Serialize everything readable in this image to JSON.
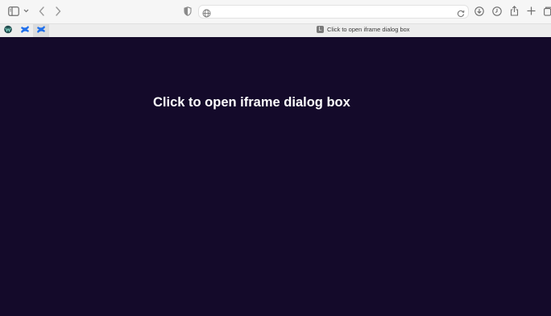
{
  "tab": {
    "favicon_letter": "L",
    "title": "Click to open iframe dialog box"
  },
  "address_bar": {
    "value": "",
    "placeholder": ""
  },
  "page": {
    "heading": "Click to open iframe dialog box",
    "background_color": "#140a2a",
    "text_color": "#ffffff"
  },
  "icons": {
    "sidebar": "sidebar-icon",
    "back": "chevron-left-icon",
    "forward": "chevron-right-icon",
    "privacy": "shield-icon",
    "download": "download-icon",
    "history": "clock-icon",
    "share": "share-icon",
    "new_tab": "plus-icon",
    "tab_overview": "tabs-overview-icon"
  }
}
